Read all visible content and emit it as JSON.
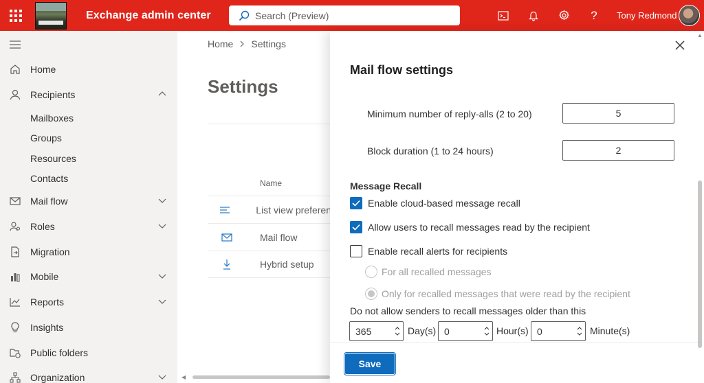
{
  "topbar": {
    "app_title": "Exchange admin center",
    "search_placeholder": "Search (Preview)",
    "user_name": "Tony Redmond",
    "bg_color": "#e0261b"
  },
  "nav": {
    "items": [
      {
        "label": "Home",
        "icon": "home-icon"
      },
      {
        "label": "Recipients",
        "icon": "person-icon",
        "expanded": true
      },
      {
        "label": "Mail flow",
        "icon": "mail-icon"
      },
      {
        "label": "Roles",
        "icon": "roles-icon"
      },
      {
        "label": "Migration",
        "icon": "migration-icon"
      },
      {
        "label": "Mobile",
        "icon": "mobile-icon"
      },
      {
        "label": "Reports",
        "icon": "reports-icon"
      },
      {
        "label": "Insights",
        "icon": "insights-icon"
      },
      {
        "label": "Public folders",
        "icon": "public-folders-icon"
      },
      {
        "label": "Organization",
        "icon": "organization-icon"
      }
    ],
    "recipients_sub": [
      "Mailboxes",
      "Groups",
      "Resources",
      "Contacts"
    ]
  },
  "main": {
    "breadcrumb": [
      "Home",
      "Settings"
    ],
    "title": "Settings",
    "column_header": "Name",
    "rows": [
      {
        "label": "List view preferen",
        "icon": "list-icon"
      },
      {
        "label": "Mail flow",
        "icon": "mail-icon"
      },
      {
        "label": "Hybrid setup",
        "icon": "download-icon"
      }
    ]
  },
  "panel": {
    "title": "Mail flow settings",
    "reply_all_label": "Minimum number of reply-alls (2 to 20)",
    "reply_all_value": "5",
    "block_label": "Block duration (1 to 24 hours)",
    "block_value": "2",
    "recall_heading": "Message Recall",
    "enable_recall": {
      "label": "Enable cloud-based message recall",
      "checked": true
    },
    "allow_recall_read": {
      "label": "Allow users to recall messages read by the recipient",
      "checked": true
    },
    "recall_alerts": {
      "label": "Enable recall alerts for recipients",
      "checked": false
    },
    "radio_all": {
      "label": "For all recalled messages",
      "selected": false
    },
    "radio_read": {
      "label": "Only for recalled messages that were read by the recipient",
      "selected": true
    },
    "retain_label": "Do not allow senders to recall messages older than this",
    "days_value": "365",
    "days_unit": "Day(s)",
    "hours_value": "0",
    "hours_unit": "Hour(s)",
    "minutes_value": "0",
    "minutes_unit": "Minute(s)",
    "save_label": "Save",
    "accent_color": "#0f6cbd"
  }
}
